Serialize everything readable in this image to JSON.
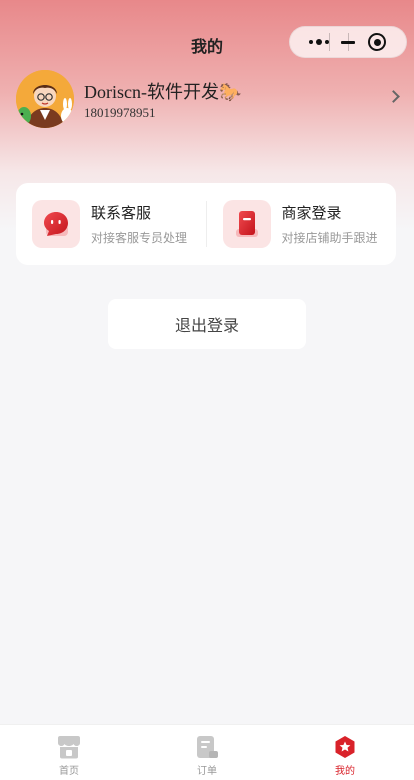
{
  "nav": {
    "title": "我的"
  },
  "profile": {
    "nickname": "Doriscn-软件开发🐎",
    "phone": "18019978951"
  },
  "quick_links": [
    {
      "title": "联系客服",
      "subtitle": "对接客服专员处理",
      "icon": "chat-bubble-icon"
    },
    {
      "title": "商家登录",
      "subtitle": "对接店铺助手跟进",
      "icon": "merchant-book-icon"
    }
  ],
  "logout_label": "退出登录",
  "tabbar": [
    {
      "label": "首页",
      "icon": "store-icon",
      "active": false
    },
    {
      "label": "订单",
      "icon": "order-doc-icon",
      "active": false
    },
    {
      "label": "我的",
      "icon": "profile-star-icon",
      "active": true
    }
  ],
  "colors": {
    "accent": "#d9222a",
    "header_gradient_top": "#e8888a",
    "background": "#f6f6f8"
  }
}
